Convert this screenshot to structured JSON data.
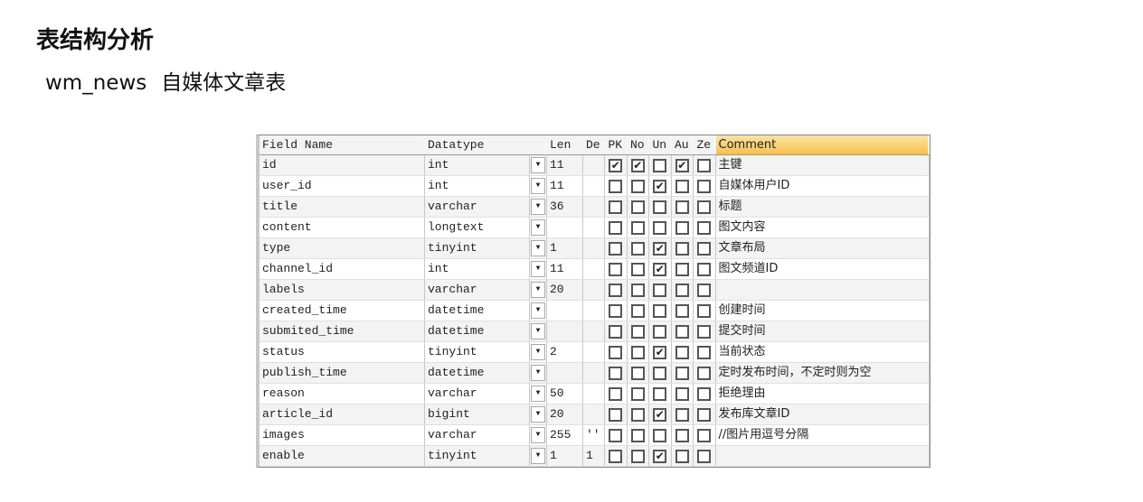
{
  "title": "表结构分析",
  "subtitle": {
    "table": "wm_news",
    "desc": "自媒体文章表"
  },
  "headers": {
    "field": "Field Name",
    "type": "Datatype",
    "len": "Len",
    "def": "De",
    "pk": "PK",
    "nn": "No",
    "un": "Un",
    "ai": "Au",
    "zf": "Ze",
    "comment": "Comment"
  },
  "rows": [
    {
      "field": "id",
      "type": "int",
      "len": "11",
      "def": "",
      "flags": [
        1,
        1,
        0,
        1,
        0
      ],
      "comment": "主键"
    },
    {
      "field": "user_id",
      "type": "int",
      "len": "11",
      "def": "",
      "flags": [
        0,
        0,
        1,
        0,
        0
      ],
      "comment": "自媒体用户ID"
    },
    {
      "field": "title",
      "type": "varchar",
      "len": "36",
      "def": "",
      "flags": [
        0,
        0,
        0,
        0,
        0
      ],
      "comment": "标题"
    },
    {
      "field": "content",
      "type": "longtext",
      "len": "",
      "def": "",
      "flags": [
        0,
        0,
        0,
        0,
        0
      ],
      "comment": "图文内容"
    },
    {
      "field": "type",
      "type": "tinyint",
      "len": "1",
      "def": "",
      "flags": [
        0,
        0,
        1,
        0,
        0
      ],
      "comment": "文章布局"
    },
    {
      "field": "channel_id",
      "type": "int",
      "len": "11",
      "def": "",
      "flags": [
        0,
        0,
        1,
        0,
        0
      ],
      "comment": "图文频道ID"
    },
    {
      "field": "labels",
      "type": "varchar",
      "len": "20",
      "def": "",
      "flags": [
        0,
        0,
        0,
        0,
        0
      ],
      "comment": ""
    },
    {
      "field": "created_time",
      "type": "datetime",
      "len": "",
      "def": "",
      "flags": [
        0,
        0,
        0,
        0,
        0
      ],
      "comment": "创建时间"
    },
    {
      "field": "submited_time",
      "type": "datetime",
      "len": "",
      "def": "",
      "flags": [
        0,
        0,
        0,
        0,
        0
      ],
      "comment": "提交时间"
    },
    {
      "field": "status",
      "type": "tinyint",
      "len": "2",
      "def": "",
      "flags": [
        0,
        0,
        1,
        0,
        0
      ],
      "comment": "当前状态"
    },
    {
      "field": "publish_time",
      "type": "datetime",
      "len": "",
      "def": "",
      "flags": [
        0,
        0,
        0,
        0,
        0
      ],
      "comment": "定时发布时间，不定时则为空"
    },
    {
      "field": "reason",
      "type": "varchar",
      "len": "50",
      "def": "",
      "flags": [
        0,
        0,
        0,
        0,
        0
      ],
      "comment": "拒绝理由"
    },
    {
      "field": "article_id",
      "type": "bigint",
      "len": "20",
      "def": "",
      "flags": [
        0,
        0,
        1,
        0,
        0
      ],
      "comment": "发布库文章ID"
    },
    {
      "field": "images",
      "type": "varchar",
      "len": "255",
      "def": "''",
      "flags": [
        0,
        0,
        0,
        0,
        0
      ],
      "comment": "//图片用逗号分隔"
    },
    {
      "field": "enable",
      "type": "tinyint",
      "len": "1",
      "def": "1",
      "flags": [
        0,
        0,
        1,
        0,
        0
      ],
      "comment": ""
    }
  ]
}
